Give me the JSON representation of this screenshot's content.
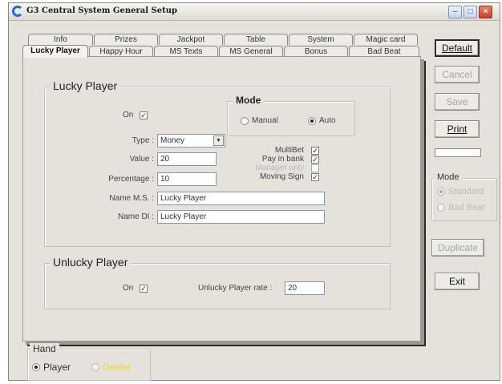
{
  "window": {
    "title": "G3 Central System General Setup",
    "controls": {
      "minimize": "–",
      "maximize": "□",
      "close": "×"
    }
  },
  "tabs": {
    "row_back": [
      "Info",
      "Prizes",
      "Jackpot",
      "Table",
      "System",
      "Magic card"
    ],
    "row_front": [
      "Lucky Player",
      "Happy Hour",
      "MS Texts",
      "MS General",
      "Bonus",
      "Bad Beat"
    ],
    "active": "Lucky Player"
  },
  "lucky_player": {
    "title": "Lucky Player",
    "on_label": "On",
    "on_checked": true,
    "type_label": "Type :",
    "type_value": "Money",
    "value_label": "Value :",
    "value_value": "20",
    "percentage_label": "Percentage :",
    "percentage_value": "10",
    "name_ms_label": "Name M.S. :",
    "name_ms_value": "Lucky Player",
    "name_di_label": "Name DI :",
    "name_di_value": "Lucky Player",
    "mode": {
      "title": "Mode",
      "manual": "Manual",
      "auto": "Auto",
      "selected": "Auto"
    },
    "options": [
      {
        "label": "MultiBet",
        "checked": true,
        "disabled": false
      },
      {
        "label": "Pay in bank",
        "checked": true,
        "disabled": false
      },
      {
        "label": "Manager only",
        "checked": false,
        "disabled": true
      },
      {
        "label": "Moving Sign",
        "checked": true,
        "disabled": false
      }
    ]
  },
  "unlucky_player": {
    "title": "Unlucky Player",
    "on_label": "On",
    "on_checked": true,
    "rate_label": "Unlucky Player rate :",
    "rate_value": "20"
  },
  "side_buttons": {
    "default": "Default",
    "cancel": "Cancel",
    "save": "Save",
    "print": "Print",
    "duplicate": "Duplicate",
    "exit": "Exit"
  },
  "side_mode": {
    "title": "Mode",
    "standard": "Standard",
    "bad_beat": "Bad Beat",
    "selected": "Standard"
  },
  "hand": {
    "title": "Hand",
    "player": "Player",
    "dealer": "Dealer",
    "selected": "Player"
  },
  "colors": {
    "dialog_bg": "#e4e2da",
    "title_bar_close": "#c8412a",
    "dealer_label": "#f2d23c",
    "disabled_text": "#a8a6a0"
  }
}
